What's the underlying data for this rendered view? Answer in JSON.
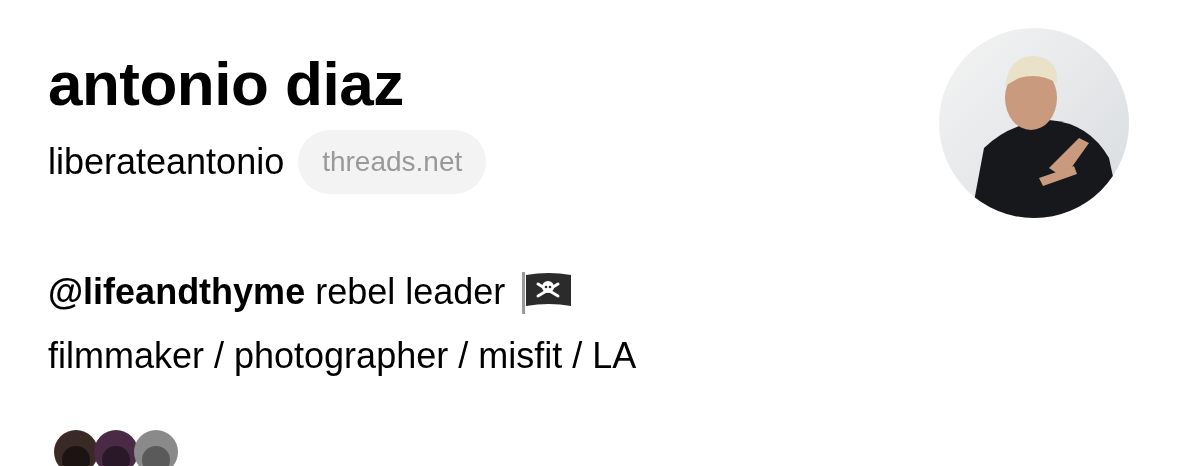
{
  "profile": {
    "name": "antonio diaz",
    "username": "liberateantonio",
    "domain_badge": "threads.net",
    "avatar": {
      "kind": "picture"
    }
  },
  "bio": [
    "**@lifeandthyme** rebel leader",
    "filmmaker / photographer / misfit / LA"
  ],
  "followers_avatars": [
    {
      "kind": "picture"
    },
    {
      "kind": "picture"
    },
    {
      "kind": "picture"
    }
  ]
}
